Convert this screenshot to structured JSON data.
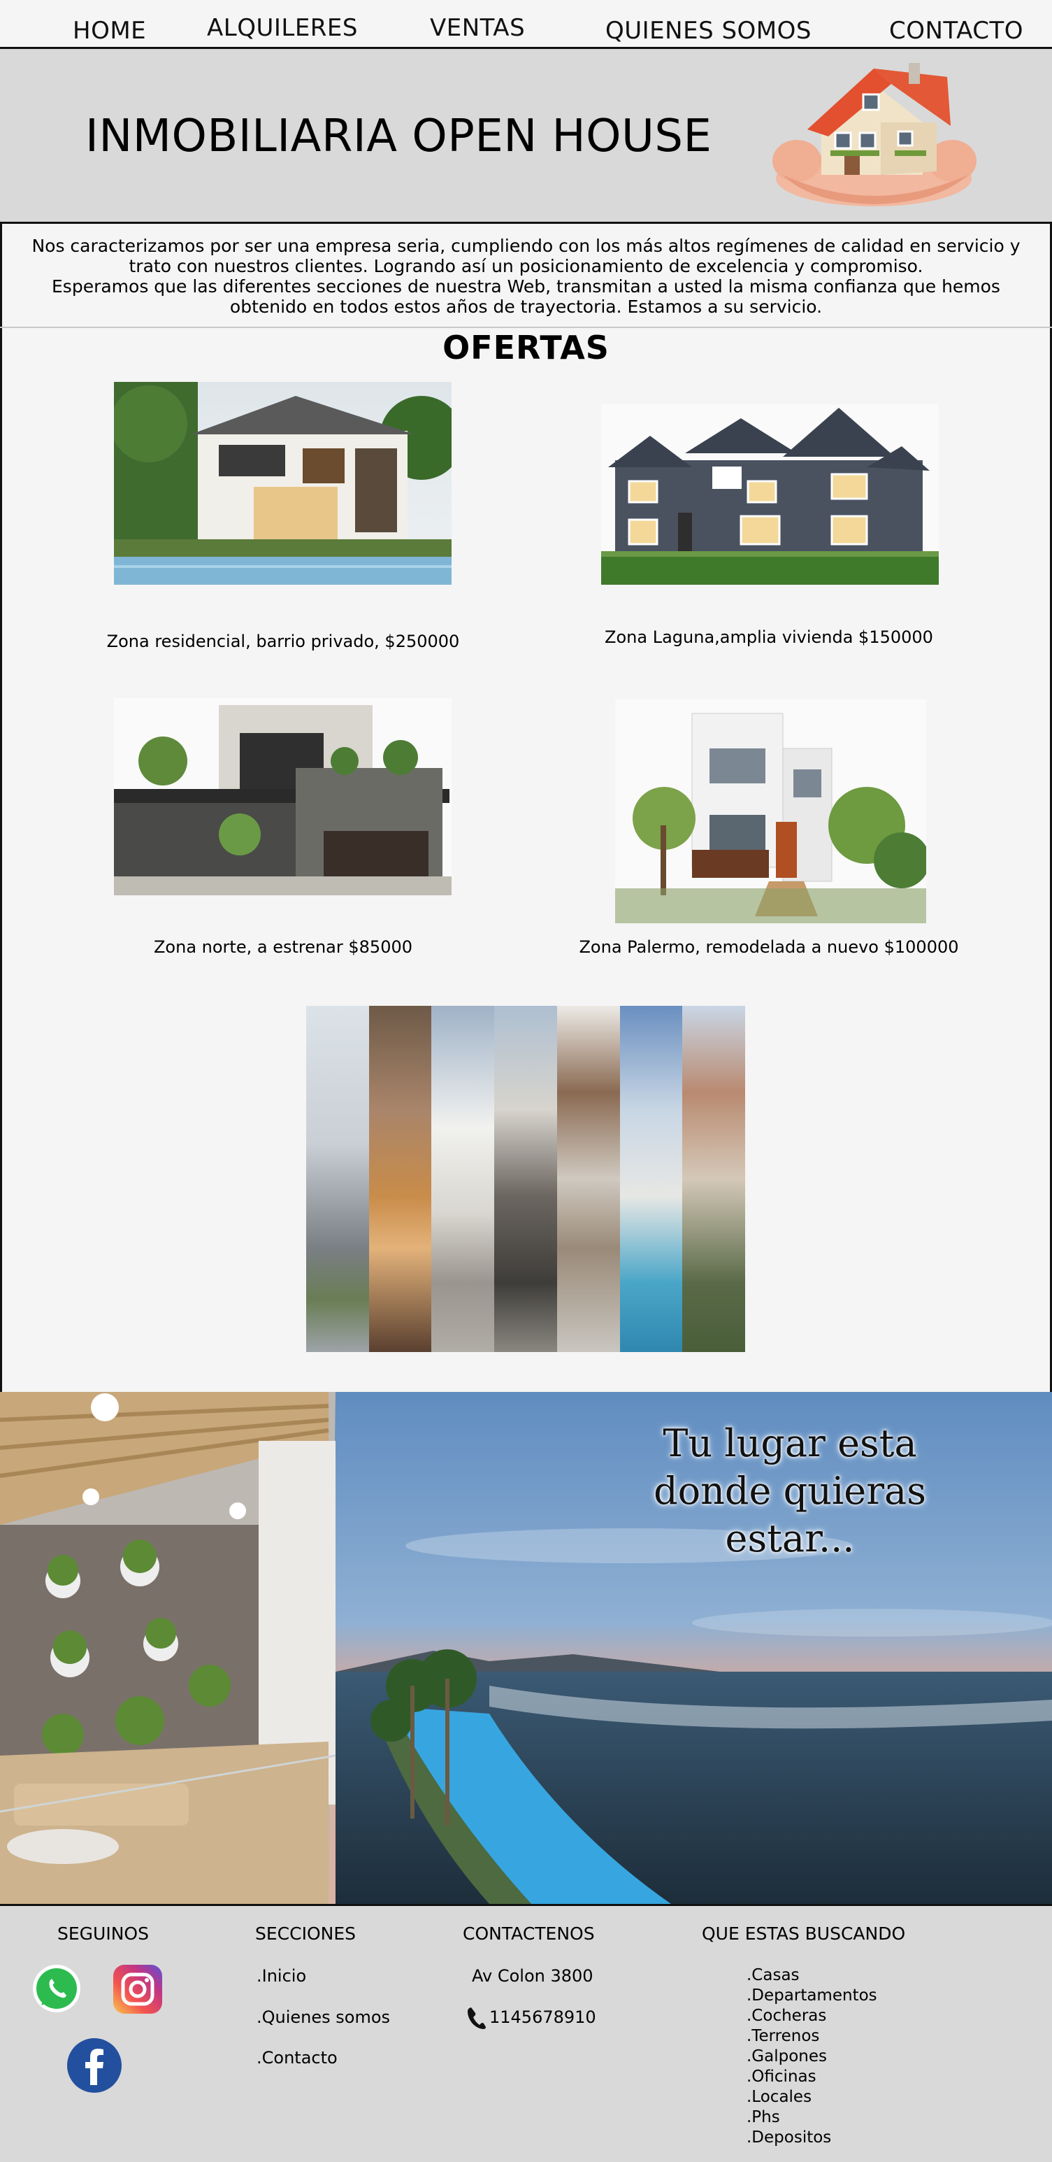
{
  "nav": {
    "home": "HOME",
    "alquileres": "ALQUILERES",
    "ventas": "VENTAS",
    "quienes": "QUIENES SOMOS",
    "contacto": "CONTACTO"
  },
  "header": {
    "title": "INMOBILIARIA OPEN HOUSE",
    "logo_icon": "house-in-hands-icon"
  },
  "intro": {
    "line1": "Nos caracterizamos por ser una empresa seria, cumpliendo con los más altos regímenes de calidad en servicio y trato con nuestros clientes. Logrando así un posicionamiento de excelencia y compromiso.",
    "line2": "Esperamos que las diferentes secciones de nuestra Web, transmitan a usted la misma confianza que hemos obtenido en todos estos años de trayectoria. Estamos a su servicio."
  },
  "ofertas": {
    "title": "OFERTAS",
    "items": [
      {
        "caption": "Zona residencial, barrio privado, $250000"
      },
      {
        "caption": "Zona Laguna,amplia vivienda $150000"
      },
      {
        "caption": "Zona norte, a estrenar $85000"
      },
      {
        "caption": "Zona Palermo, remodelada a nuevo $100000"
      }
    ]
  },
  "hero": {
    "line1": "Tu lugar esta",
    "line2": "donde quieras",
    "line3": "estar..."
  },
  "footer": {
    "seguinos": "SEGUINOS",
    "secciones": "SECCIONES",
    "contactenos": "CONTACTENOS",
    "buscando": "QUE ESTAS BUSCANDO",
    "social_icons": [
      "whatsapp-icon",
      "instagram-icon",
      "facebook-icon"
    ],
    "secciones_items": [
      ".Inicio",
      ".Quienes somos",
      ".Contacto"
    ],
    "address": "Av Colon 3800",
    "phone": "1145678910",
    "buscando_items": [
      ".Casas",
      ".Departamentos",
      ".Cocheras",
      ".Terrenos",
      ".Galpones",
      ".Oficinas",
      ".Locales",
      ".Phs",
      ".Depositos"
    ]
  }
}
